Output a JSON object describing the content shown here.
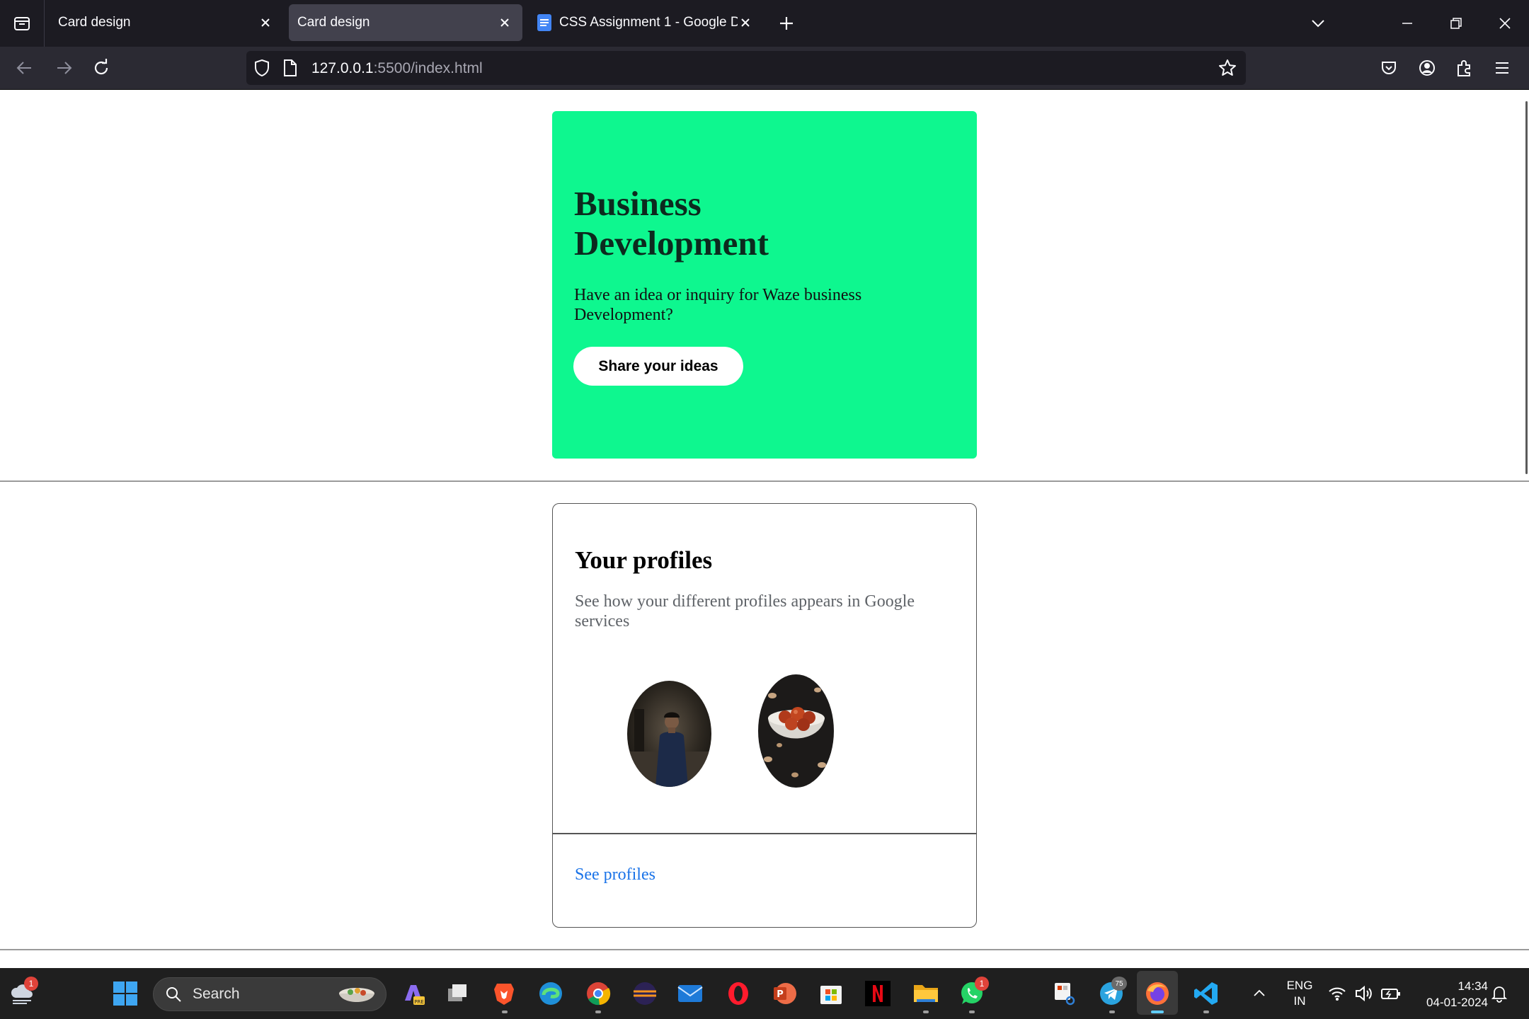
{
  "browser": {
    "tabs": [
      {
        "title": "Card design",
        "active": false
      },
      {
        "title": "Card design",
        "active": true
      },
      {
        "title": "CSS Assignment 1 - Google Docs",
        "active": false
      }
    ],
    "url_host": "127.0.0.1",
    "url_rest": ":5500/index.html"
  },
  "page": {
    "business_card": {
      "title": "Business Development",
      "description": "Have an idea or inquiry for Waze business Development?",
      "button_label": "Share your ideas",
      "background": "#0ef78f"
    },
    "profiles_card": {
      "title": "Your profiles",
      "description": "See how your different profiles appears in Google services",
      "link_label": "See profiles",
      "link_color": "#1a73e8"
    }
  },
  "taskbar": {
    "search_label": "Search",
    "weather_badge": "1",
    "whatsapp_badge": "1",
    "telegram_badge": "75",
    "language_line1": "ENG",
    "language_line2": "IN",
    "time": "14:34",
    "date": "04-01-2024"
  }
}
